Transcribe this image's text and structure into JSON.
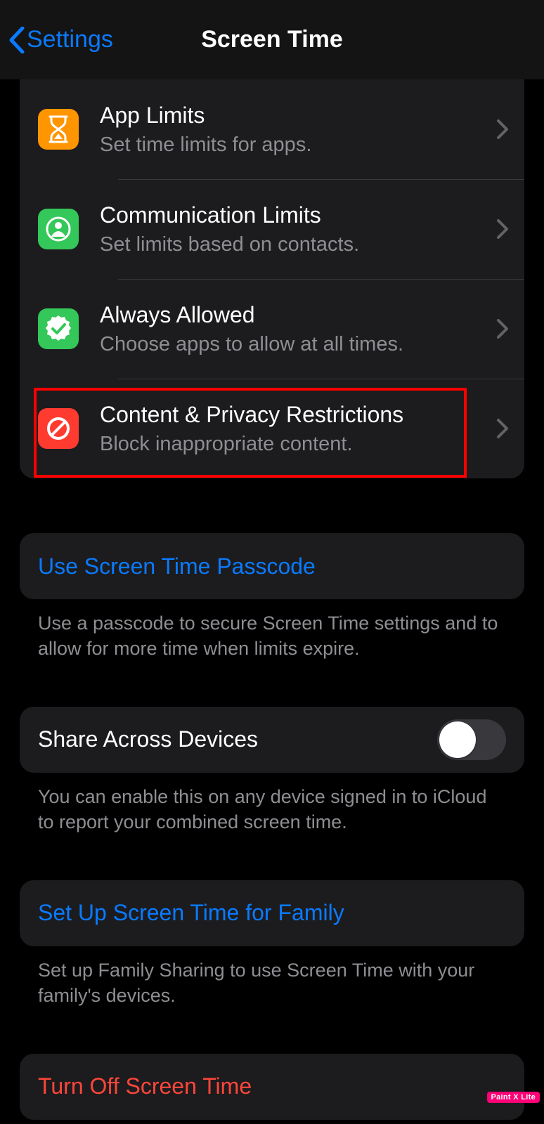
{
  "nav": {
    "back_label": "Settings",
    "title": "Screen Time"
  },
  "rows": {
    "app_limits": {
      "title": "App Limits",
      "sub": "Set time limits for apps."
    },
    "comm_limits": {
      "title": "Communication Limits",
      "sub": "Set limits based on contacts."
    },
    "always": {
      "title": "Always Allowed",
      "sub": "Choose apps to allow at all times."
    },
    "content": {
      "title": "Content & Privacy Restrictions",
      "sub": "Block inappropriate content."
    }
  },
  "passcode": {
    "label": "Use Screen Time Passcode",
    "footer": "Use a passcode to secure Screen Time settings and to allow for more time when limits expire."
  },
  "share": {
    "label": "Share Across Devices",
    "footer": "You can enable this on any device signed in to iCloud to report your combined screen time."
  },
  "family": {
    "label": "Set Up Screen Time for Family",
    "footer": "Set up Family Sharing to use Screen Time with your family's devices."
  },
  "turnoff": {
    "label": "Turn Off Screen Time"
  },
  "watermark": "Paint X Lite"
}
